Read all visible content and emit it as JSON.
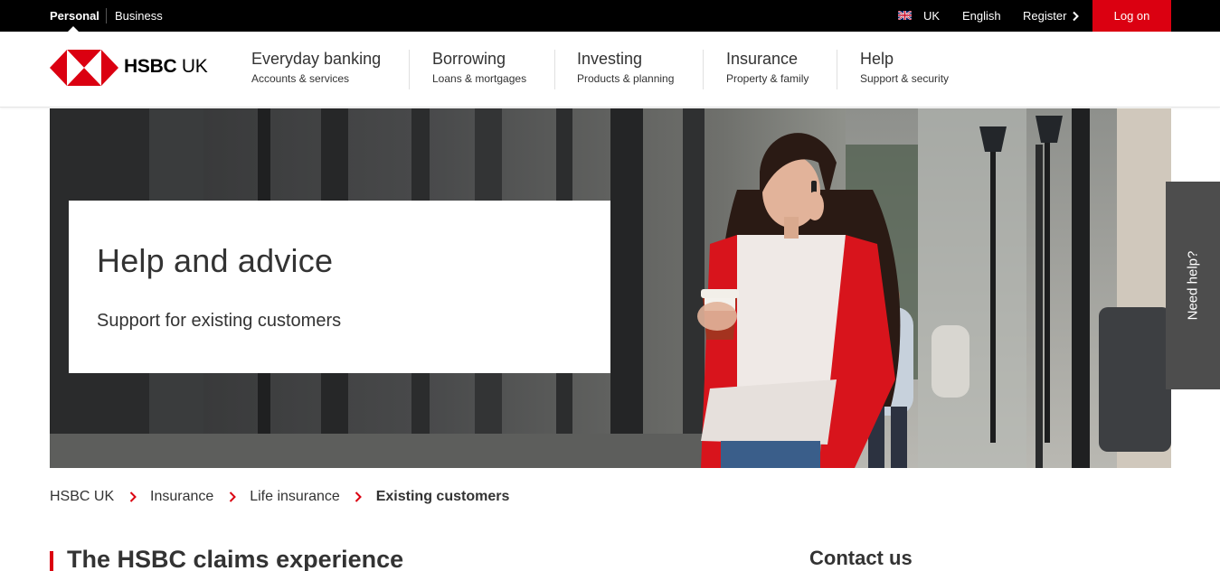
{
  "topbar": {
    "personal_label": "Personal",
    "business_label": "Business",
    "country_label": "UK",
    "language_label": "English",
    "register_label": "Register",
    "logon_label": "Log on"
  },
  "brand": {
    "name": "HSBC",
    "region": "UK",
    "primary_color": "#db0011"
  },
  "nav": {
    "items": [
      {
        "title": "Everyday banking",
        "subtitle": "Accounts & services"
      },
      {
        "title": "Borrowing",
        "subtitle": "Loans & mortgages"
      },
      {
        "title": "Investing",
        "subtitle": "Products & planning"
      },
      {
        "title": "Insurance",
        "subtitle": "Property & family"
      },
      {
        "title": "Help",
        "subtitle": "Support & security"
      }
    ]
  },
  "hero": {
    "title": "Help and advice",
    "subtitle": "Support for existing customers"
  },
  "need_help": {
    "label": "Need help?"
  },
  "breadcrumb": {
    "items": [
      "HSBC UK",
      "Insurance",
      "Life insurance"
    ],
    "current": "Existing customers"
  },
  "main": {
    "section_title": "The HSBC claims experience"
  },
  "aside": {
    "title": "Contact us"
  }
}
